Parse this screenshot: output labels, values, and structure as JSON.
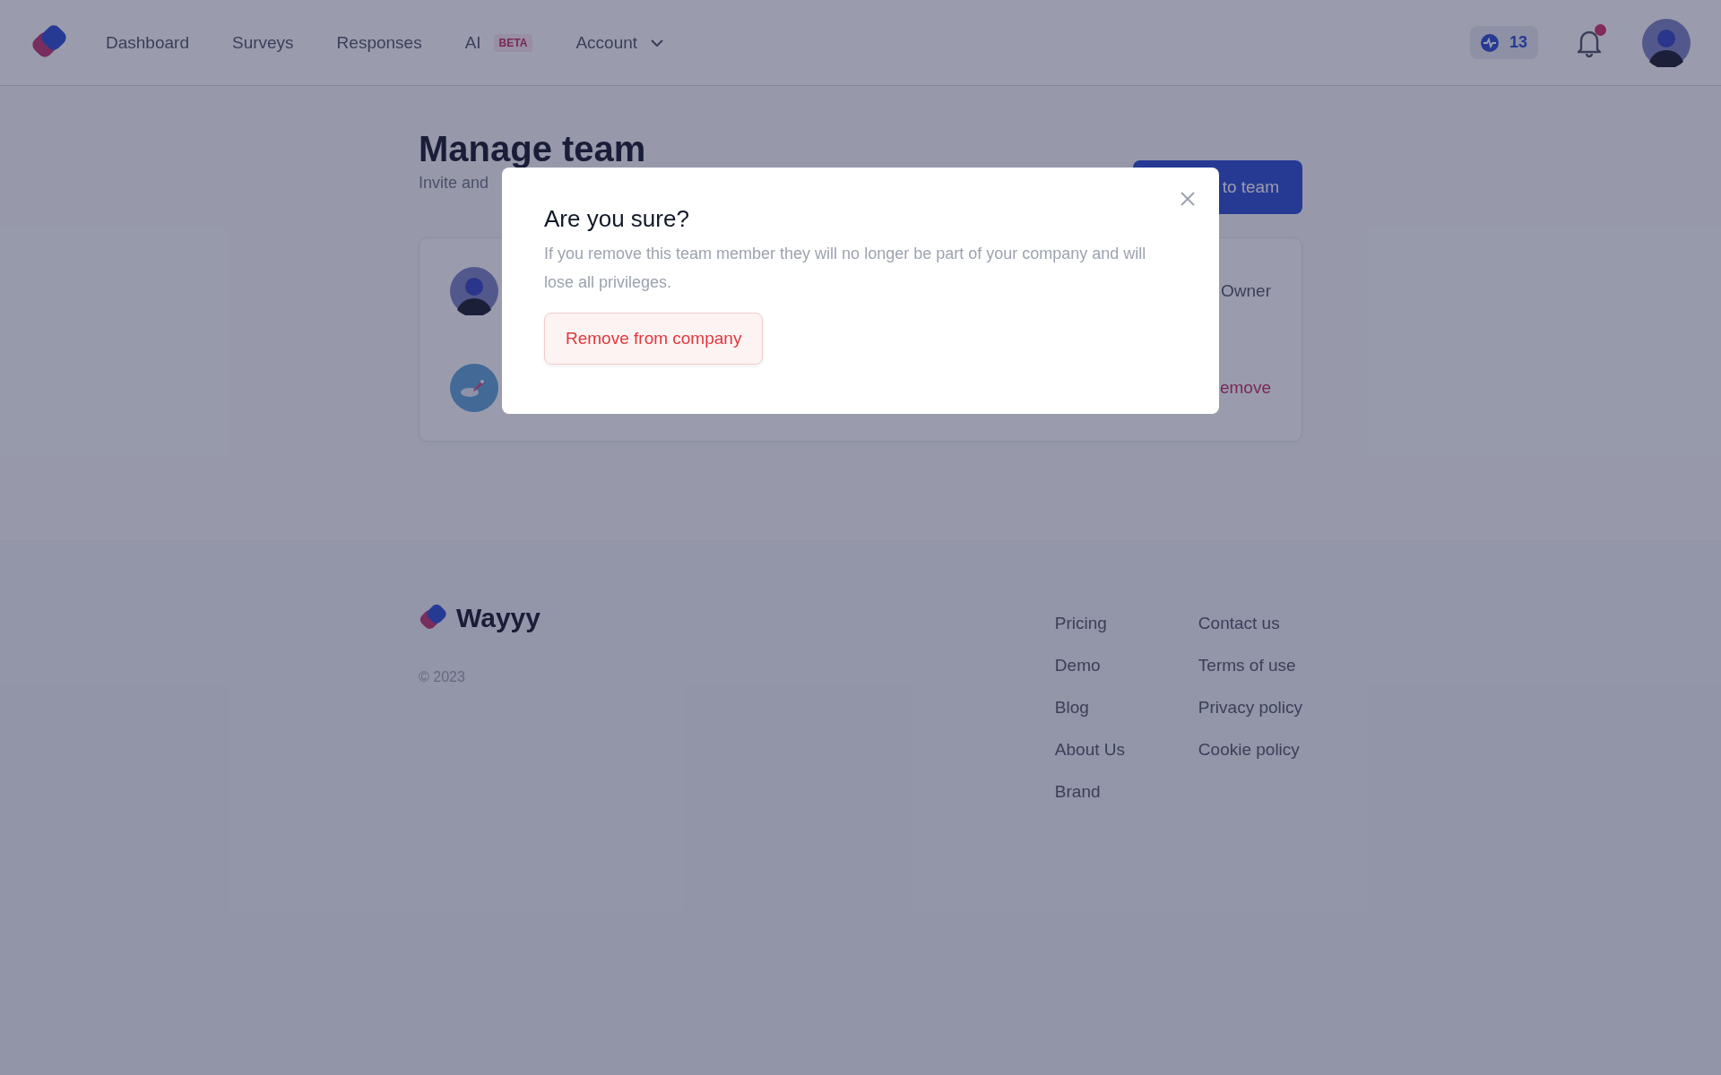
{
  "nav": {
    "items": [
      {
        "label": "Dashboard"
      },
      {
        "label": "Surveys"
      },
      {
        "label": "Responses"
      },
      {
        "label": "AI",
        "badge": "BETA"
      },
      {
        "label": "Account",
        "dropdown": true
      }
    ]
  },
  "credits": "13",
  "notifications": {
    "unread": true
  },
  "page": {
    "title": "Manage team",
    "subtitle": "Invite and",
    "add_button": "to team"
  },
  "members": [
    {
      "kind": "role",
      "text": "Owner"
    },
    {
      "kind": "action",
      "text": "emove"
    }
  ],
  "modal": {
    "title": "Are you sure?",
    "message": "If you remove this team member they will no longer be part of your company and will lose all privileges.",
    "confirm_button": "Remove from company"
  },
  "footer": {
    "brand": "Wayyy",
    "copyright": "© 2023",
    "columns": [
      [
        "Pricing",
        "Demo",
        "Blog",
        "About Us",
        "Brand"
      ],
      [
        "Contact us",
        "Terms of use",
        "Privacy policy",
        "Cookie policy"
      ]
    ]
  }
}
